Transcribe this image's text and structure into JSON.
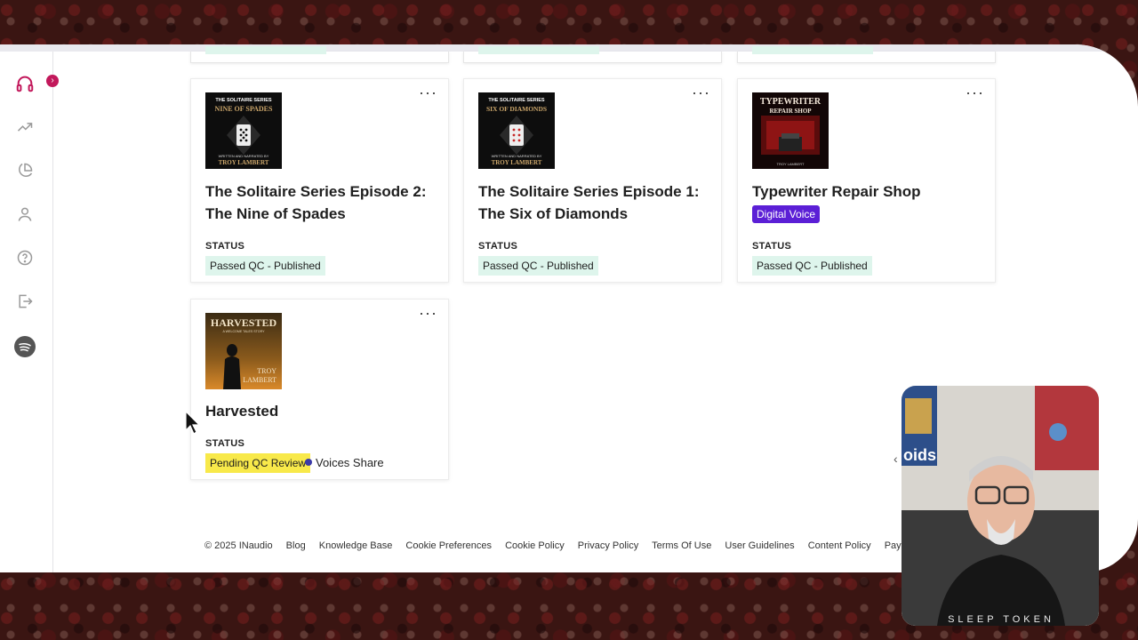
{
  "sidebar": {
    "badge": "›",
    "icons": [
      "headphones-icon",
      "trending-icon",
      "pie-chart-icon",
      "user-icon",
      "help-icon",
      "logout-icon",
      "spotify-icon"
    ]
  },
  "cards": [
    {
      "title": "The Solitaire Series Episode 2: The Nine of Spades",
      "status_label": "STATUS",
      "status": "Passed QC - Published",
      "cover": {
        "series": "THE SOLITAIRE SERIES",
        "name": "NINE OF SPADES",
        "byline": "WRITTEN AND NARRATED BY",
        "author": "TROY LAMBERT"
      }
    },
    {
      "title": "The Solitaire Series Episode 1: The Six of Diamonds",
      "status_label": "STATUS",
      "status": "Passed QC - Published",
      "cover": {
        "series": "THE SOLITAIRE SERIES",
        "name": "SIX OF DIAMONDS",
        "byline": "WRITTEN AND NARRATED BY",
        "author": "TROY LAMBERT"
      }
    },
    {
      "title": "Typewriter Repair Shop",
      "badge": "Digital Voice",
      "status_label": "STATUS",
      "status": "Passed QC - Published",
      "cover": {
        "name": "TYPEWRITER",
        "sub": "REPAIR SHOP",
        "author": "TROY LAMBERT"
      }
    },
    {
      "title": "Harvested",
      "status_label": "STATUS",
      "status": "Pending QC Review",
      "share": "Voices Share",
      "cover": {
        "name": "HARVESTED",
        "tag": "A WELCOME TALES STORY",
        "author_first": "TROY",
        "author_last": "LAMBERT"
      }
    }
  ],
  "footer": {
    "copyright": "© 2025 INaudio",
    "links": [
      "Blog",
      "Knowledge Base",
      "Cookie Preferences",
      "Cookie Policy",
      "Privacy Policy",
      "Terms Of Use",
      "User Guidelines",
      "Content Policy",
      "Payment T"
    ]
  },
  "webcam": {
    "shirt_text": "SLEEP TOKEN",
    "poster_text": "oids"
  },
  "colors": {
    "published_bg": "#def5ec",
    "pending_bg": "#f8e94a",
    "digital_voice": "#5b1fd6",
    "accent": "#c2185b"
  }
}
